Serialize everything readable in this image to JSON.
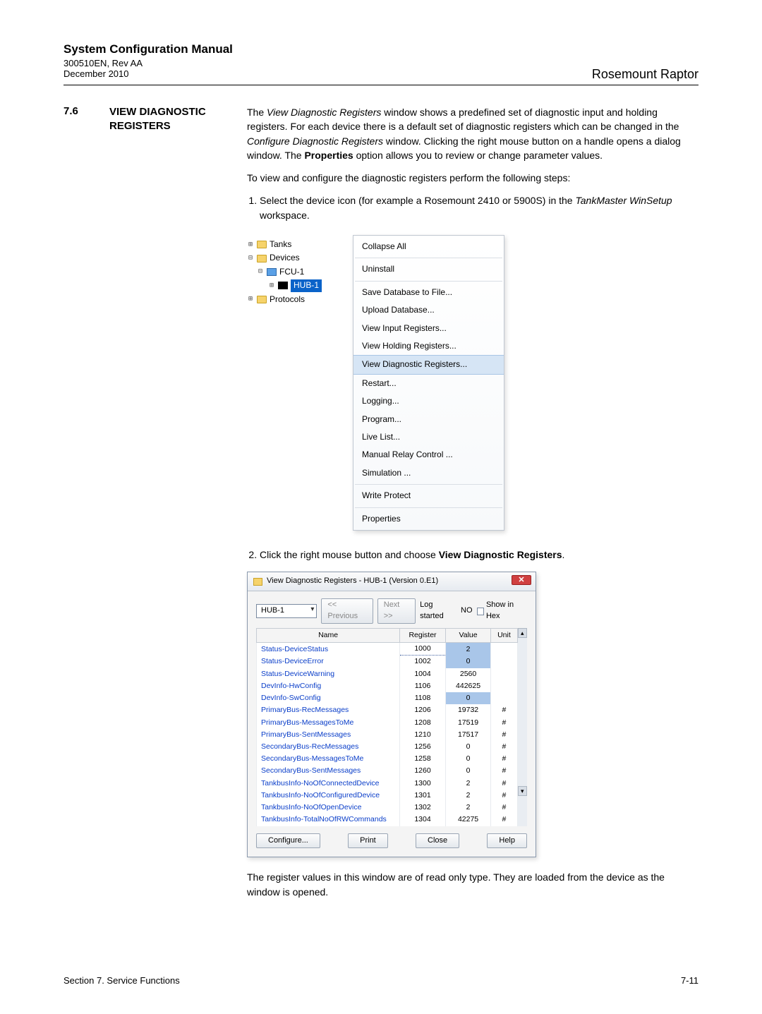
{
  "doc": {
    "title": "System Configuration Manual",
    "sub": "300510EN, Rev AA",
    "date": "December 2010",
    "brand": "Rosemount Raptor"
  },
  "section": {
    "num": "7.6",
    "title": "VIEW DIAGNOSTIC REGISTERS",
    "para1_a": "The ",
    "para1_b": "View Diagnostic Registers",
    "para1_c": " window shows a predefined set of diagnostic input and holding registers. For each device there is a default set of diagnostic registers which can be changed in the ",
    "para1_d": "Configure Diagnostic Registers",
    "para1_e": " window. Clicking the right mouse button on a handle opens a dialog window. The ",
    "para1_f": "Properties",
    "para1_g": " option allows you to review or change parameter values.",
    "para2": "To view and configure the diagnostic registers perform the following steps:",
    "step1_a": "Select the device icon (for example a Rosemount 2410 or 5900S) in the ",
    "step1_b": "TankMaster WinSetup",
    "step1_c": " workspace.",
    "step2_a": "Click the right mouse button and choose ",
    "step2_b": "View Diagnostic Registers",
    "step2_c": ".",
    "para3": "The register values in this window are of read only type. They are loaded from the device as the window is opened."
  },
  "tree": {
    "tanks": "Tanks",
    "devices": "Devices",
    "fcu": "FCU-1",
    "hub": "HUB-1",
    "protocols": "Protocols"
  },
  "ctx": {
    "items": [
      "Collapse All",
      "Uninstall",
      "Save Database to File...",
      "Upload Database...",
      "View Input Registers...",
      "View Holding Registers...",
      "View Diagnostic Registers...",
      "Restart...",
      "Logging...",
      "Program...",
      "Live List...",
      "Manual Relay Control ...",
      "Simulation ...",
      "Write Protect",
      "Properties"
    ]
  },
  "dlg": {
    "title": "View Diagnostic Registers - HUB-1 (Version 0.E1)",
    "combo": "HUB-1",
    "prev": "<< Previous",
    "next": "Next >>",
    "log_started": "Log started",
    "log_val": "NO",
    "show_hex": "Show in Hex",
    "headers": {
      "name": "Name",
      "reg": "Register",
      "val": "Value",
      "unit": "Unit"
    },
    "rows": [
      {
        "name": "Status-DeviceStatus",
        "reg": "1000",
        "val": "2",
        "unit": ""
      },
      {
        "name": "Status-DeviceError",
        "reg": "1002",
        "val": "0",
        "unit": ""
      },
      {
        "name": "Status-DeviceWarning",
        "reg": "1004",
        "val": "2560",
        "unit": ""
      },
      {
        "name": "DevInfo-HwConfig",
        "reg": "1106",
        "val": "442625",
        "unit": ""
      },
      {
        "name": "DevInfo-SwConfig",
        "reg": "1108",
        "val": "0",
        "unit": ""
      },
      {
        "name": "PrimaryBus-RecMessages",
        "reg": "1206",
        "val": "19732",
        "unit": "#"
      },
      {
        "name": "PrimaryBus-MessagesToMe",
        "reg": "1208",
        "val": "17519",
        "unit": "#"
      },
      {
        "name": "PrimaryBus-SentMessages",
        "reg": "1210",
        "val": "17517",
        "unit": "#"
      },
      {
        "name": "SecondaryBus-RecMessages",
        "reg": "1256",
        "val": "0",
        "unit": "#"
      },
      {
        "name": "SecondaryBus-MessagesToMe",
        "reg": "1258",
        "val": "0",
        "unit": "#"
      },
      {
        "name": "SecondaryBus-SentMessages",
        "reg": "1260",
        "val": "0",
        "unit": "#"
      },
      {
        "name": "TankbusInfo-NoOfConnectedDevice",
        "reg": "1300",
        "val": "2",
        "unit": "#"
      },
      {
        "name": "TankbusInfo-NoOfConfiguredDevice",
        "reg": "1301",
        "val": "2",
        "unit": "#"
      },
      {
        "name": "TankbusInfo-NoOfOpenDevice",
        "reg": "1302",
        "val": "2",
        "unit": "#"
      },
      {
        "name": "TankbusInfo-TotalNoOfRWCommands",
        "reg": "1304",
        "val": "42275",
        "unit": "#"
      }
    ],
    "buttons": {
      "configure": "Configure...",
      "print": "Print",
      "close": "Close",
      "help": "Help"
    }
  },
  "footer": {
    "left": "Section 7. Service Functions",
    "right": "7-11"
  }
}
